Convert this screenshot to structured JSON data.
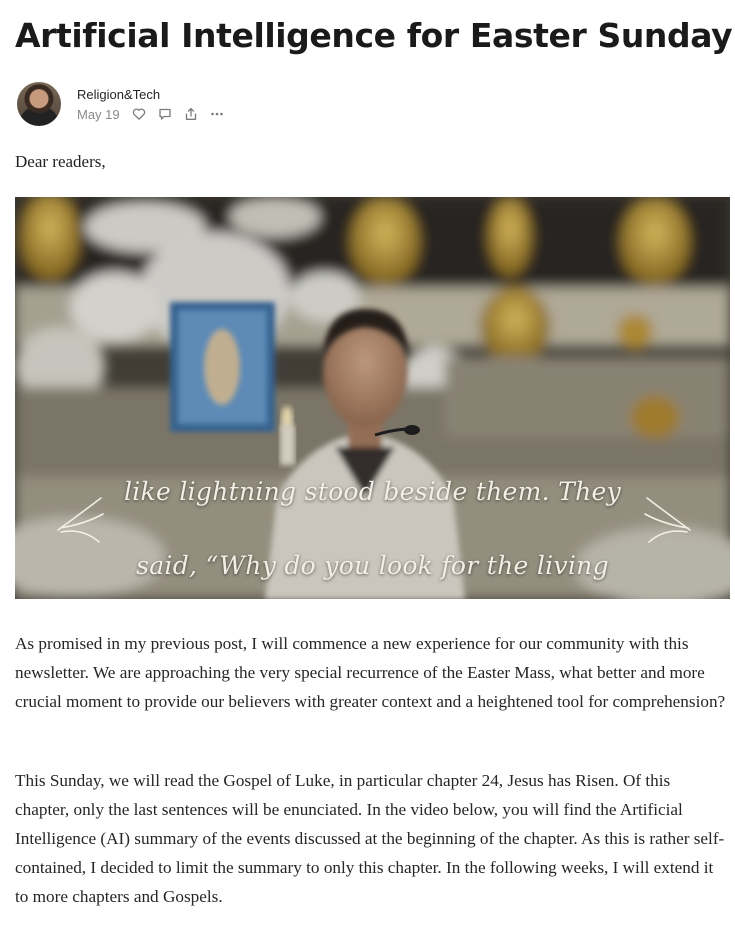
{
  "post": {
    "title": "Artificial Intelligence for Easter Sunday",
    "author": "Religion&Tech",
    "date": "May 19",
    "greeting": "Dear readers,"
  },
  "icons": {
    "like": "heart-icon",
    "comment": "comment-icon",
    "share": "share-icon",
    "more": "more-icon"
  },
  "video": {
    "caption_line1": "like lightning stood beside them. They",
    "caption_line2": "said, “Why do you look for the living"
  },
  "body": {
    "paragraph1": "As promised in my previous post, I will commence a new experience for our community with this newsletter. We are approaching the very special recurrence of the Easter Mass, what better and more crucial moment to provide our believers with greater context and a heightened tool for comprehension?",
    "paragraph2": "This Sunday, we will read the Gospel of Luke, in particular chapter 24, Jesus has Risen. Of this chapter, only the last sentences will be enunciated. In the video below, you will find the Artificial Intelligence (AI) summary of the events discussed at the beginning of the chapter. As this is rather self-contained, I decided to limit the summary to only this chapter. In the following weeks, I will extend it to more chapters and Gospels."
  }
}
